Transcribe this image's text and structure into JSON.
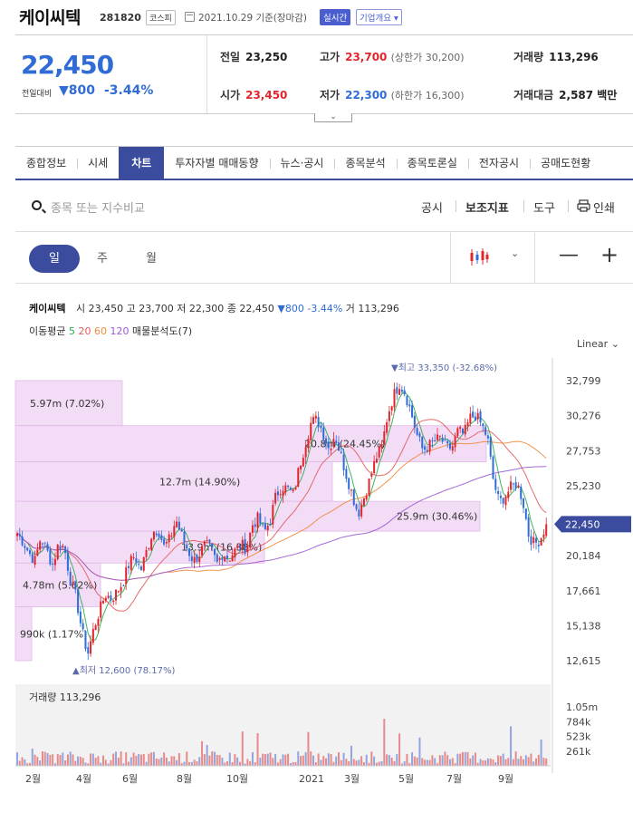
{
  "header": {
    "name": "케이씨텍",
    "code": "281820",
    "market": "코스피",
    "date": "2021.10.29 기준(장마감)",
    "live_label": "실시간",
    "corp_label": "기업개요 ▾"
  },
  "summary": {
    "price": "22,450",
    "change_label": "전일대비",
    "change_value": "▼800",
    "change_pct": "-3.44%",
    "prev_close_label": "전일",
    "prev_close": "23,250",
    "high_label": "고가",
    "high": "23,700",
    "high_limit": "(상한가 30,200)",
    "volume_label": "거래량",
    "volume": "113,296",
    "open_label": "시가",
    "open": "23,450",
    "low_label": "저가",
    "low": "22,300",
    "low_limit": "(하한가 16,300)",
    "amount_label": "거래대금",
    "amount": "2,587 백만",
    "toggle_icon": "chevron-down"
  },
  "tabs": [
    "종합정보",
    "시세",
    "차트",
    "투자자별 매매동향",
    "뉴스·공시",
    "종목분석",
    "종목토론실",
    "전자공시",
    "공매도현황"
  ],
  "active_tab": "차트",
  "search": {
    "placeholder": "종목 또는 지수비교",
    "buttons": [
      "공시",
      "보조지표",
      "도구",
      "인쇄"
    ]
  },
  "periods": [
    "일",
    "주",
    "월"
  ],
  "active_period": "일",
  "legend": {
    "name": "케이씨텍",
    "open": "시 23,450",
    "high": "고 23,700",
    "low": "저 22,300",
    "close": "종 22,450",
    "change": "▼800 -3.44%",
    "volume": "거 113,296",
    "ma_label": "이동평균",
    "ma": [
      "5",
      "20",
      "60",
      "120"
    ],
    "volume_profile": "매물분석도(7)"
  },
  "scale_label": "Linear",
  "colors": {
    "accent": "#3b4b9e",
    "up": "#e0262d",
    "down": "#2f6cd6",
    "ma5": "#2eaa4f",
    "ma20": "#e35b5b",
    "ma60": "#f08a3c",
    "ma120": "#9b59d0",
    "profile": "#f3dcf6"
  },
  "chart_data": {
    "type": "candlestick",
    "y_axis": [
      "32,799",
      "30,276",
      "27,753",
      "25,230",
      "22,450",
      "20,184",
      "17,661",
      "15,138",
      "12,615"
    ],
    "y_range": [
      12615,
      32799
    ],
    "x_axis": [
      "2월",
      "4월",
      "6월",
      "8월",
      "10월",
      "2021",
      "3월",
      "5월",
      "7월",
      "9월"
    ],
    "current_price": "22,450",
    "max_label": "▼최고 33,350 (-32.68%)",
    "min_label": "▲최저 12,600 (78.17%)",
    "close_path": [
      21800,
      21200,
      20400,
      19800,
      21500,
      20600,
      19500,
      21000,
      20800,
      18500,
      17200,
      14800,
      13100,
      14900,
      16200,
      17400,
      17100,
      17600,
      18300,
      19600,
      20200,
      19100,
      20500,
      21900,
      22100,
      20800,
      21400,
      22800,
      21600,
      20600,
      19800,
      20300,
      21000,
      20600,
      19600,
      20400,
      20000,
      20500,
      21000,
      20700,
      22400,
      22900,
      21800,
      22700,
      24500,
      25200,
      25000,
      24600,
      26600,
      28200,
      29800,
      30000,
      29100,
      27900,
      28900,
      27500,
      26000,
      24600,
      23200,
      24400,
      25700,
      27200,
      28000,
      30300,
      31700,
      32600,
      31900,
      30500,
      28900,
      27800,
      28100,
      28400,
      28700,
      27900,
      28000,
      29200,
      28900,
      30100,
      30300,
      29600,
      28700,
      25600,
      24000,
      24500,
      25100,
      25400,
      24200,
      21700,
      21000,
      21400,
      22450
    ],
    "ma_visible": true,
    "volume_profile": [
      {
        "label": "5.97m (7.02%)"
      },
      {
        "label": "20.8m (24.45%)"
      },
      {
        "label": "12.7m (14.90%)"
      },
      {
        "label": "25.9m (30.46%)"
      },
      {
        "label": "13.9m (16.38%)"
      },
      {
        "label": "4.78m (5.62%)"
      },
      {
        "label": "990k (1.17%)"
      }
    ],
    "volume": {
      "title": "거래량 113,296",
      "axis": [
        "1.05m",
        "784k",
        "523k",
        "261k"
      ],
      "unit_max": 1050000
    }
  }
}
